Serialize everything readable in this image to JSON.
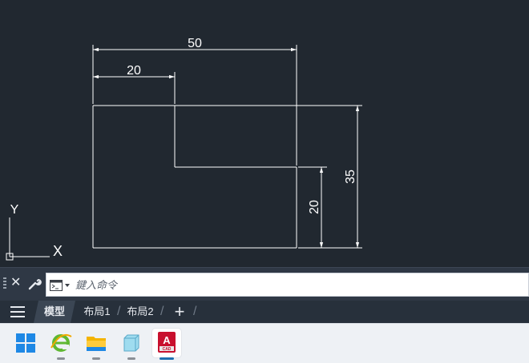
{
  "drawing": {
    "dimensions": {
      "top_total": "50",
      "top_partial": "20",
      "right_total": "35",
      "right_partial": "20"
    },
    "ucs": {
      "x_label": "X",
      "y_label": "Y"
    },
    "colors": {
      "background": "#212830",
      "geometry": "#ffffff"
    }
  },
  "command_line": {
    "placeholder": "鍵入命令",
    "close_icon": "close-icon",
    "settings_icon": "wrench-icon"
  },
  "layout_tabs": {
    "tabs": [
      {
        "label": "模型",
        "active": true
      },
      {
        "label": "布局1",
        "active": false
      },
      {
        "label": "布局2",
        "active": false
      }
    ],
    "add_label": "+"
  },
  "taskbar": {
    "apps": [
      {
        "name": "start-windows-icon",
        "active": false
      },
      {
        "name": "internet-explorer-icon",
        "active": false
      },
      {
        "name": "file-explorer-icon",
        "active": false
      },
      {
        "name": "cube-app-icon",
        "active": false
      },
      {
        "name": "autocad-icon",
        "label": "A",
        "sublabel": "CAD",
        "active": true
      }
    ]
  }
}
